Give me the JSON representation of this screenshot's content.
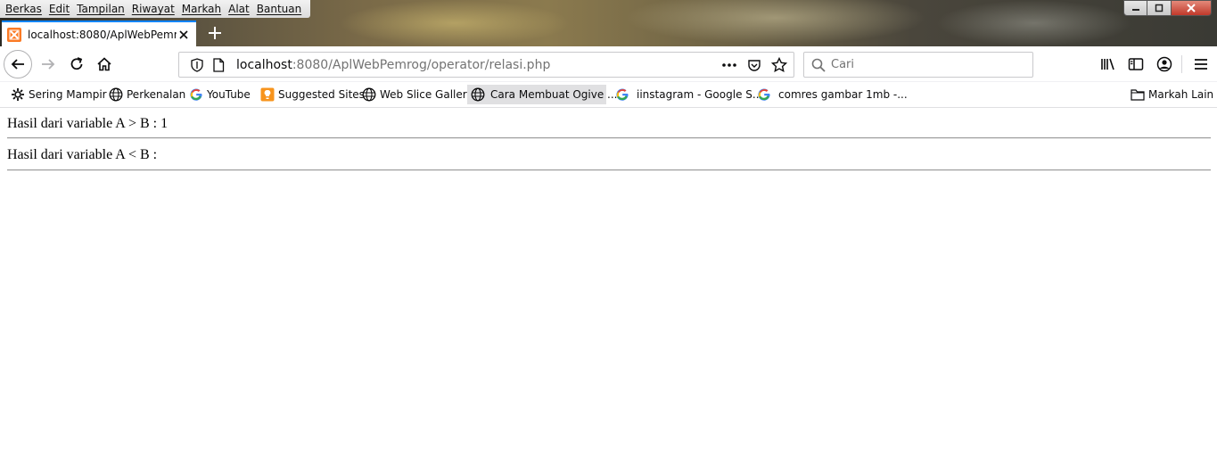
{
  "menubar": {
    "items": [
      "Berkas",
      "Edit",
      "Tampilan",
      "Riwayat",
      "Markah",
      "Alat",
      "Bantuan"
    ]
  },
  "tab": {
    "title": "localhost:8080/AplWebPemrog",
    "favicon_color": "#fb7a24"
  },
  "navbar": {
    "url_host": "localhost",
    "url_rest": ":8080/AplWebPemrog/operator/relasi.php",
    "search_placeholder": "Cari"
  },
  "bookmarks": {
    "items": [
      {
        "label": "Sering Mampir",
        "icon": "gear-icon"
      },
      {
        "label": "Perkenalan",
        "icon": "globe-icon"
      },
      {
        "label": "YouTube",
        "icon": "google-icon"
      },
      {
        "label": "Suggested Sites",
        "icon": "suggested-icon"
      },
      {
        "label": "Web Slice Gallery",
        "icon": "globe-icon"
      },
      {
        "label": "Cara Membuat Ogive ...",
        "icon": "globe-icon"
      },
      {
        "label": "iinstagram - Google S...",
        "icon": "google-icon"
      },
      {
        "label": "comres gambar 1mb -...",
        "icon": "google-icon"
      }
    ],
    "other": "Markah Lain"
  },
  "page": {
    "line1": "Hasil dari variable A > B : 1",
    "line2": "Hasil dari variable A < B :"
  },
  "colors": {
    "accent": "#0a84ff",
    "close_button": "#c0392b"
  }
}
